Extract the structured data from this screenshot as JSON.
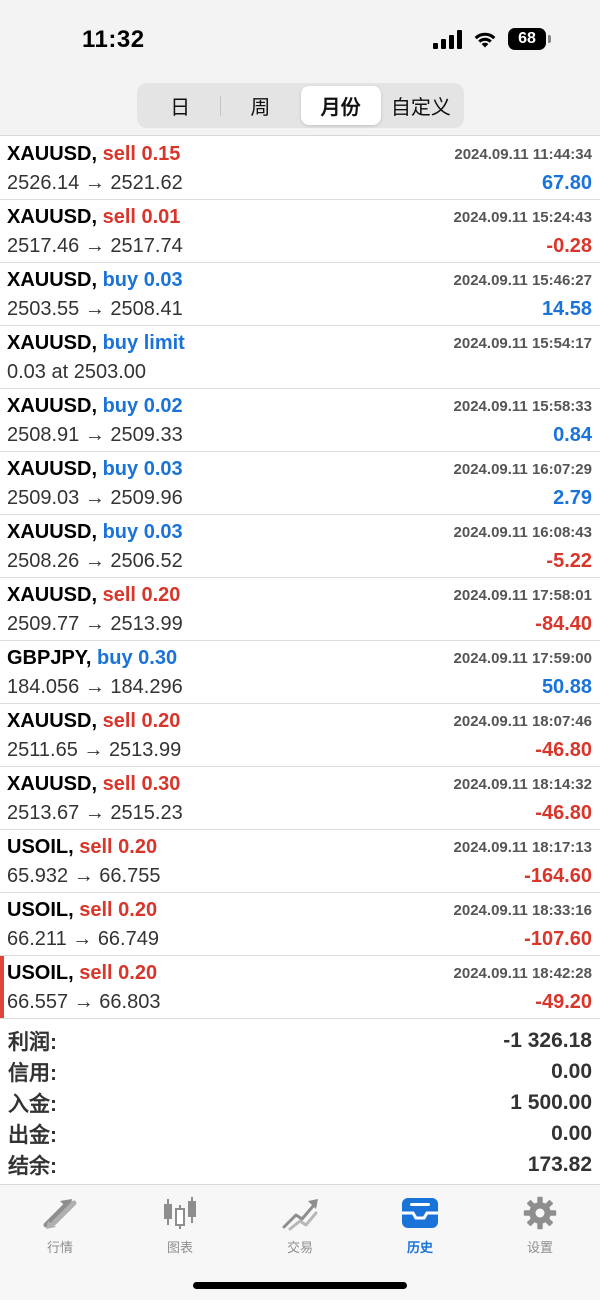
{
  "status": {
    "time": "11:32",
    "battery": "68"
  },
  "segments": [
    {
      "label": "日"
    },
    {
      "label": "周"
    },
    {
      "label": "月份"
    },
    {
      "label": "自定义"
    }
  ],
  "rows": [
    {
      "symbol": "XAUUSD,",
      "side": "sell",
      "qty": "0.15",
      "time": "2024.09.11 11:44:34",
      "open": "2526.14",
      "close": "2521.62",
      "profit": "67.80"
    },
    {
      "symbol": "XAUUSD,",
      "side": "sell",
      "qty": "0.01",
      "time": "2024.09.11 15:24:43",
      "open": "2517.46",
      "close": "2517.74",
      "profit": "-0.28"
    },
    {
      "symbol": "XAUUSD,",
      "side": "buy",
      "qty": "0.03",
      "time": "2024.09.11 15:46:27",
      "open": "2503.55",
      "close": "2508.41",
      "profit": "14.58"
    },
    {
      "symbol": "XAUUSD,",
      "side": "buy",
      "qty": "limit",
      "time": "2024.09.11 15:54:17",
      "detail": "0.03 at 2503.00",
      "profit": ""
    },
    {
      "symbol": "XAUUSD,",
      "side": "buy",
      "qty": "0.02",
      "time": "2024.09.11 15:58:33",
      "open": "2508.91",
      "close": "2509.33",
      "profit": "0.84"
    },
    {
      "symbol": "XAUUSD,",
      "side": "buy",
      "qty": "0.03",
      "time": "2024.09.11 16:07:29",
      "open": "2509.03",
      "close": "2509.96",
      "profit": "2.79"
    },
    {
      "symbol": "XAUUSD,",
      "side": "buy",
      "qty": "0.03",
      "time": "2024.09.11 16:08:43",
      "open": "2508.26",
      "close": "2506.52",
      "profit": "-5.22"
    },
    {
      "symbol": "XAUUSD,",
      "side": "sell",
      "qty": "0.20",
      "time": "2024.09.11 17:58:01",
      "open": "2509.77",
      "close": "2513.99",
      "profit": "-84.40"
    },
    {
      "symbol": "GBPJPY,",
      "side": "buy",
      "qty": "0.30",
      "time": "2024.09.11 17:59:00",
      "open": "184.056",
      "close": "184.296",
      "profit": "50.88"
    },
    {
      "symbol": "XAUUSD,",
      "side": "sell",
      "qty": "0.20",
      "time": "2024.09.11 18:07:46",
      "open": "2511.65",
      "close": "2513.99",
      "profit": "-46.80"
    },
    {
      "symbol": "XAUUSD,",
      "side": "sell",
      "qty": "0.30",
      "time": "2024.09.11 18:14:32",
      "open": "2513.67",
      "close": "2515.23",
      "profit": "-46.80"
    },
    {
      "symbol": "USOIL,",
      "side": "sell",
      "qty": "0.20",
      "time": "2024.09.11 18:17:13",
      "open": "65.932",
      "close": "66.755",
      "profit": "-164.60"
    },
    {
      "symbol": "USOIL,",
      "side": "sell",
      "qty": "0.20",
      "time": "2024.09.11 18:33:16",
      "open": "66.211",
      "close": "66.749",
      "profit": "-107.60"
    },
    {
      "symbol": "USOIL,",
      "side": "sell",
      "qty": "0.20",
      "time": "2024.09.11 18:42:28",
      "open": "66.557",
      "close": "66.803",
      "profit": "-49.20"
    }
  ],
  "arrow": "→",
  "summary": [
    {
      "label": "利润:",
      "value": "-1 326.18"
    },
    {
      "label": "信用:",
      "value": "0.00"
    },
    {
      "label": "入金:",
      "value": "1 500.00"
    },
    {
      "label": "出金:",
      "value": "0.00"
    },
    {
      "label": "结余:",
      "value": "173.82"
    }
  ],
  "tabs": [
    {
      "label": "行情",
      "icon": "quotes-arrows-icon"
    },
    {
      "label": "图表",
      "icon": "candlestick-chart-icon"
    },
    {
      "label": "交易",
      "icon": "trade-trend-icon"
    },
    {
      "label": "历史",
      "icon": "history-inbox-icon"
    },
    {
      "label": "设置",
      "icon": "gear-icon"
    }
  ],
  "colors": {
    "sell": "#d9362b",
    "buy": "#1a73d9",
    "active_tab": "#1a73d9"
  }
}
